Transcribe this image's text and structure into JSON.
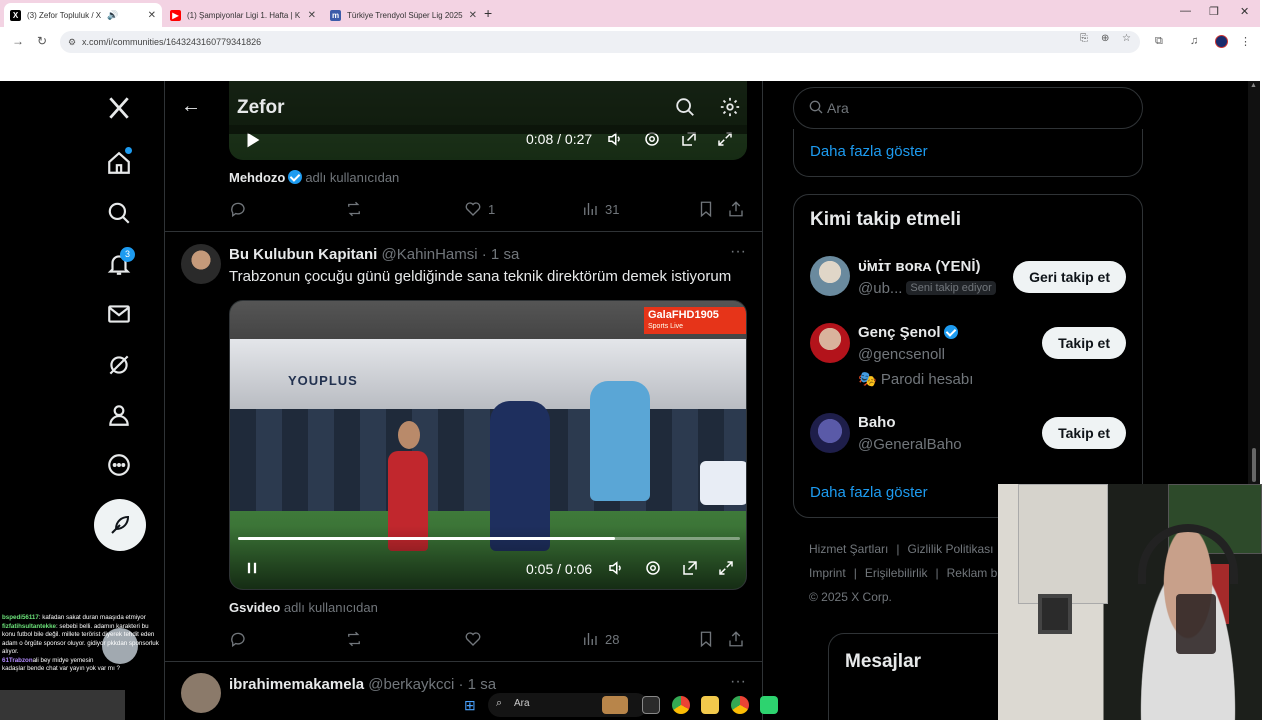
{
  "browser": {
    "tabs": [
      {
        "label": "(3) Zefor Topluluk / X",
        "favicon": "x-favicon",
        "active": true
      },
      {
        "label": "(1) Şampiyonlar Ligi 1. Hafta | K",
        "favicon": "youtube-favicon",
        "active": false
      },
      {
        "label": "Türkiye Trendyol Süper Lig 2025",
        "favicon": "m-favicon",
        "active": false
      }
    ],
    "url": "x.com/i/communities/1643243160779341826"
  },
  "header": {
    "title": "Zefor"
  },
  "video_top": {
    "time": "0:08 / 0:27",
    "author_name": "Mehdozo",
    "author_suffix": "adlı kullanıcıdan",
    "likes": "1",
    "views": "31"
  },
  "tweet2": {
    "name": "Bu Kulubun Kapitani",
    "handle": "@KahinHamsi",
    "time": "· 1 sa",
    "text": "Trabzonun çocuğu günü geldiğinde sana teknik direktörüm demek istiyorum",
    "video_logo": "GalaFHD1905",
    "video_logo_sub": "Sports Live",
    "video_banner": "YOUPLUS",
    "video_time": "0:05 / 0:06",
    "video_progress": 0.75,
    "source_name": "Gsvideo",
    "source_suffix": "adlı kullanıcıdan",
    "views": "28"
  },
  "tweet3": {
    "name": "ibrahimemakamela",
    "handle": "@berkaykcci",
    "time": "· 1 sa"
  },
  "nav": {
    "notification_count": "3"
  },
  "right": {
    "search_placeholder": "Ara",
    "show_more": "Daha fazla göster",
    "follow_title": "Kimi takip etmeli",
    "suggestions": [
      {
        "name": "ᴜ̈ᴍɪ̇ᴛ ʙᴏʀᴀ (YENİ)",
        "handle": "@ub...",
        "tag": "Seni takip ediyor",
        "button": "Geri takip et"
      },
      {
        "name": "Genç Şenol",
        "handle": "@gencsenoll",
        "parody": "🎭 Parodi hesabı",
        "button": "Takip et"
      },
      {
        "name": "Baho",
        "handle": "@GeneralBaho",
        "button": "Takip et"
      }
    ],
    "show_more_2": "Daha fazla göster",
    "footer": {
      "terms": "Hizmet Şartları",
      "privacy": "Gizlilik Politikası",
      "imprint": "Imprint",
      "accessibility": "Erişilebilirlik",
      "ads": "Reklam b",
      "copyright": "© 2025 X Corp."
    },
    "messages_title": "Mesajlar"
  },
  "chat": {
    "lines": [
      {
        "user": "bspedi56117",
        "text": ": kafadan sakat duran maaşıda etmiyor"
      },
      {
        "user": "fizfatihsultantekke",
        "text": ": sebebi belli. adamın karakteri bu konu futbol bile değil. millete terörist diyerek tehdit eden adam o örgüte sponsor oluyor. gidiyor pkkdan sponsorluk alıyor."
      },
      {
        "user": "61Trabzon",
        "text": "ali bey midye yemesin"
      },
      {
        "user": "",
        "text": "kadaşlar bende chat var yayın yok var mı ?"
      }
    ]
  },
  "taskbar": {
    "search_placeholder": "Ara"
  }
}
